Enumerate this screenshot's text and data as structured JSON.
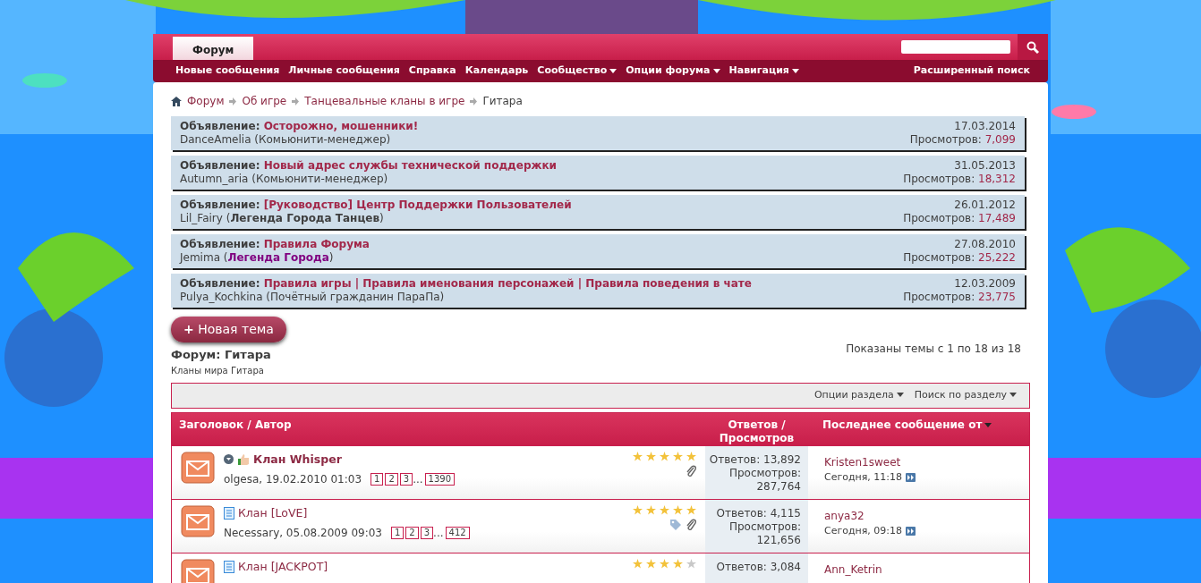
{
  "top_tabs": [
    {
      "label": "Форум",
      "selected": true
    }
  ],
  "navbar": {
    "items": [
      {
        "label": "Новые сообщения",
        "dropdown": false
      },
      {
        "label": "Личные сообщения",
        "dropdown": false
      },
      {
        "label": "Справка",
        "dropdown": false
      },
      {
        "label": "Календарь",
        "dropdown": false
      },
      {
        "label": "Сообщество",
        "dropdown": true
      },
      {
        "label": "Опции форума",
        "dropdown": true
      },
      {
        "label": "Навигация",
        "dropdown": true
      }
    ],
    "advanced_search": "Расширенный поиск"
  },
  "breadcrumbs": [
    {
      "label": "Форум",
      "link": true
    },
    {
      "label": "Об игре",
      "link": true
    },
    {
      "label": "Танцевальные кланы в игре",
      "link": true
    },
    {
      "label": "Гитара",
      "link": false
    }
  ],
  "announcements": [
    {
      "label": "Объявление:",
      "title": "Осторожно, мошенники!",
      "author": "DanceAmelia",
      "role": "(Комьюнити-менеджер)",
      "date": "17.03.2014",
      "views_label": "Просмотров:",
      "views": "7,099"
    },
    {
      "label": "Объявление:",
      "title": "Новый адрес службы технической поддержки",
      "author": "Autumn_aria",
      "role": "(Комьюнити-менеджер)",
      "date": "31.05.2013",
      "views_label": "Просмотров:",
      "views": "18,312"
    },
    {
      "label": "Объявление:",
      "title": "[Руководство] Центр Поддержки Пользователей",
      "author": "Lil_Fairy",
      "role": "(**Легенда Города Танцев**)",
      "date": "26.01.2012",
      "views_label": "Просмотров:",
      "views": "17,489"
    },
    {
      "label": "Объявление:",
      "title": "Правила Форума",
      "author": "Jemima",
      "role": "(**Легенда Города**)",
      "color": "#800080",
      "date": "27.08.2010",
      "views_label": "Просмотров:",
      "views": "25,222"
    },
    {
      "label": "Объявление:",
      "title": "Правила игры | Правила именования персонажей | Правила поведения в чате",
      "author": "Pulya_Kochkina",
      "role": "(Почётный гражданин ПараПа)",
      "date": "12.03.2009",
      "views_label": "Просмотров:",
      "views": "23,775"
    }
  ],
  "new_topic_button": {
    "icon": "+",
    "label": "Новая тема"
  },
  "forum": {
    "title": "Форум: Гитара",
    "subtitle": "Кланы мира Гитара",
    "shown": "Показаны темы с 1 по 18 из 18"
  },
  "toolbar": [
    {
      "label": "Опции раздела"
    },
    {
      "label": "Поиск по разделу"
    }
  ],
  "table": {
    "columns": [
      "Заголовок / Автор",
      "Ответов / Просмотров",
      "Последнее сообщение от"
    ],
    "rows": [
      {
        "title": "Клан Whisper",
        "kind": "sticky",
        "author_date": "olgesa, 19.02.2010 01:03",
        "pages": [
          "1",
          "2",
          "3",
          "1390"
        ],
        "ellipsis": "...",
        "stars": 5,
        "tagged": false,
        "attachment": true,
        "replies": "Ответов: 13,892",
        "views": "Просмотров: 287,764",
        "last_user": "Kristen1sweet",
        "last_time": "Сегодня, 11:18"
      },
      {
        "title": "Клан [LoVE]",
        "kind": "normal",
        "author_date": "Necessary, 05.08.2009 09:03",
        "pages": [
          "1",
          "2",
          "3",
          "412"
        ],
        "ellipsis": "...",
        "stars": 5,
        "tagged": true,
        "attachment": true,
        "replies": "Ответов: 4,115",
        "views": "Просмотров: 121,656",
        "last_user": "anya32",
        "last_time": "Сегодня, 09:18"
      },
      {
        "title": "Клан [JACKPOT]",
        "kind": "normal",
        "stars": 4,
        "tagged": false,
        "attachment": false,
        "replies": "Ответов: 3,084",
        "last_user": "Ann_Ketrin"
      }
    ]
  }
}
